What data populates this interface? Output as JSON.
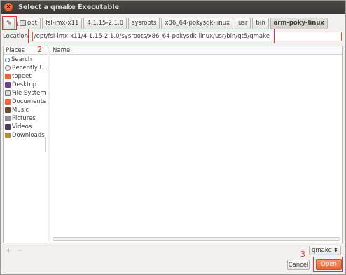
{
  "window": {
    "title": "Select a qmake Executable",
    "close_glyph": "×"
  },
  "pathbar": {
    "edit_icon_glyph": "✎",
    "segments": [
      "opt",
      "fsl-imx-x11",
      "4.1.15-2.1.0",
      "sysroots",
      "x86_64-pokysdk-linux",
      "usr",
      "bin",
      "arm-poky-linux"
    ]
  },
  "location": {
    "label": "Location:",
    "value": "/opt/fsl-imx-x11/4.1.15-2.1.0/sysroots/x86_64-pokysdk-linux/usr/bin/qt5/qmake"
  },
  "places": {
    "header": "Places",
    "items": [
      {
        "label": "Search",
        "icon": "search-icon"
      },
      {
        "label": "Recently U...",
        "icon": "clock-icon"
      },
      {
        "label": "topeet",
        "icon": "home-icon"
      },
      {
        "label": "Desktop",
        "icon": "desktop-icon"
      },
      {
        "label": "File System",
        "icon": "drive-icon"
      },
      {
        "label": "Documents",
        "icon": "documents-icon"
      },
      {
        "label": "Music",
        "icon": "music-icon"
      },
      {
        "label": "Pictures",
        "icon": "pictures-icon"
      },
      {
        "label": "Videos",
        "icon": "videos-icon"
      },
      {
        "label": "Downloads",
        "icon": "downloads-icon"
      }
    ]
  },
  "files": {
    "header": "Name"
  },
  "sidebar_controls": {
    "add": "+",
    "remove": "−"
  },
  "filter": {
    "value": "qmake",
    "arrow": "⬍"
  },
  "buttons": {
    "cancel": "Cancel",
    "open": "Open"
  },
  "annotations": {
    "one": "1",
    "two": "2",
    "three": "3"
  },
  "colors": {
    "accent": "#e86533",
    "annotation": "#e8322d",
    "titlebar": "#3b3a37"
  }
}
